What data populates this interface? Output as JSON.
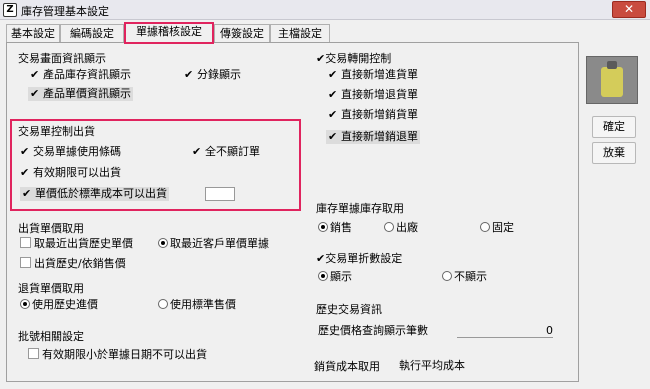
{
  "window": {
    "title": "庫存管理基本設定",
    "icon_char": "Z",
    "close_label": "✕"
  },
  "tabs": [
    {
      "label": "基本設定"
    },
    {
      "label": "編碼設定"
    },
    {
      "label": "單據稽核設定"
    },
    {
      "label": "傳簽設定"
    },
    {
      "label": "主檔設定"
    }
  ],
  "sections": {
    "display": {
      "title": "交易畫面資訊顯示",
      "items": [
        {
          "label": "產品庫存資訊顯示",
          "checked": true
        },
        {
          "label": "分錄顯示",
          "checked": true
        },
        {
          "label": "產品單價資訊顯示",
          "checked": true
        }
      ]
    },
    "link": {
      "title": "交易轉開控制",
      "items": [
        {
          "label": "直接新增進貨單",
          "checked": true
        },
        {
          "label": "直接新增退貨單",
          "checked": true
        },
        {
          "label": "直接新增銷貨單",
          "checked": true
        },
        {
          "label": "直接新增銷退單",
          "checked": true
        }
      ]
    },
    "sale_control": {
      "title": "交易單控制出貨",
      "items": [
        {
          "label": "交易單據使用條碼",
          "checked": true
        },
        {
          "label": "全不顯訂單",
          "checked": true
        },
        {
          "label": "有效期限可以出貨",
          "checked": true
        },
        {
          "label": "單價低於標準成本可以出貨",
          "checked": true
        }
      ]
    },
    "ship": {
      "title": "出貨單價取用",
      "items": [
        {
          "label": "取最近出貨歷史單價",
          "checked": false
        },
        {
          "label": "取最近客戶單價單據",
          "selected": true
        },
        {
          "label": "出貨歷史/依銷售價",
          "checked": false
        }
      ]
    },
    "return": {
      "title": "退貨單價取用",
      "options": [
        {
          "label": "使用歷史進價",
          "selected": true
        },
        {
          "label": "使用標準售價",
          "selected": false
        }
      ]
    },
    "batch": {
      "title": "批號相關設定",
      "items": [
        {
          "label": "有效期限小於單據日期不可以出貨",
          "checked": false
        }
      ]
    },
    "inventory_source": {
      "title": "庫存單據庫存取用",
      "options": [
        {
          "label": "銷售",
          "selected": true
        },
        {
          "label": "出廠",
          "selected": false
        },
        {
          "label": "固定",
          "selected": false
        }
      ]
    },
    "discount": {
      "title": "交易單折數設定",
      "options": [
        {
          "label": "顯示",
          "selected": true
        },
        {
          "label": "不顯示",
          "selected": false
        }
      ]
    },
    "history": {
      "title": "歷史交易資訊",
      "field_label": "歷史價格查詢顯示筆數",
      "field_value": "0"
    },
    "cost": {
      "label": "銷貨成本取用",
      "value": "執行平均成本"
    }
  },
  "sidebar": {
    "image_icon": "traffic-light-icon",
    "confirm_label": "確定",
    "cancel_label": "放棄"
  },
  "colors": {
    "highlight": "#e0245e",
    "close": "#c94b3f"
  }
}
